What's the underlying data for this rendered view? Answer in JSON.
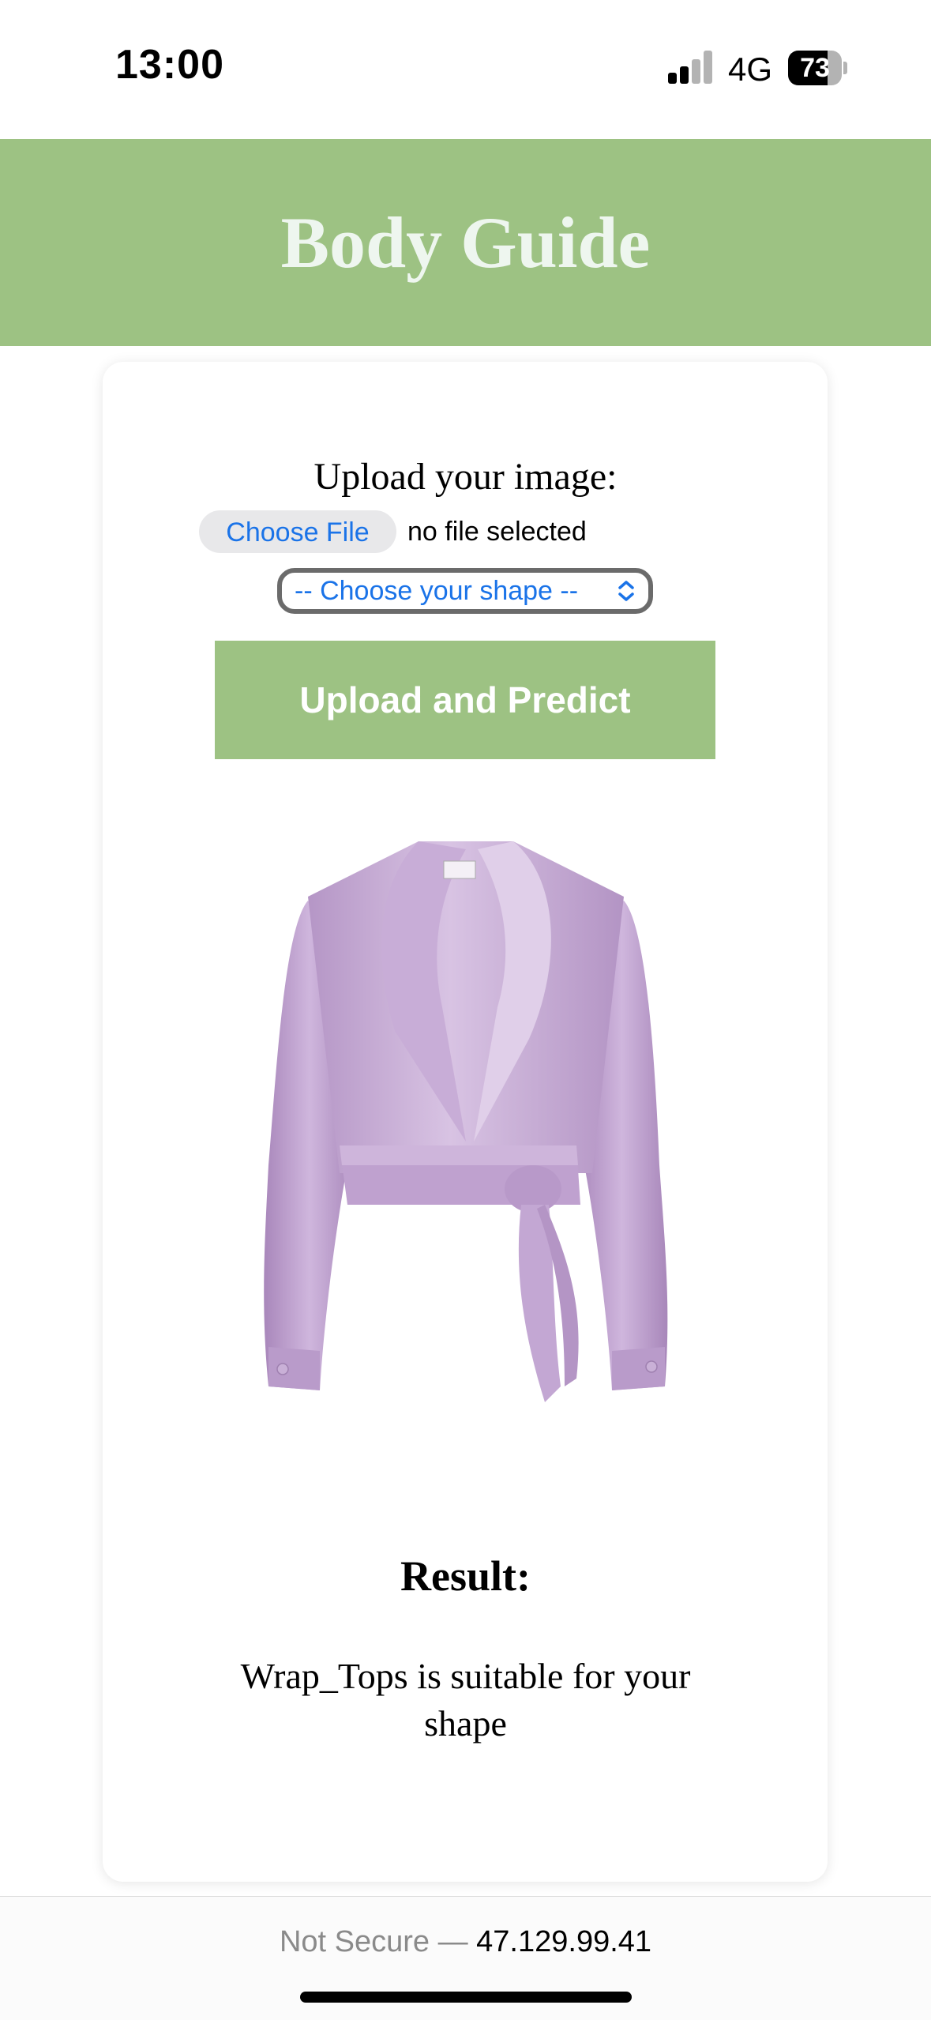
{
  "status_bar": {
    "time": "13:00",
    "network": "4G",
    "battery_percent": "73",
    "battery_level": 0.73,
    "signal_bars_active": 2,
    "signal_bars_total": 4
  },
  "header": {
    "title": "Body Guide",
    "color": "#9dc283"
  },
  "form": {
    "upload_label": "Upload your image:",
    "choose_file_label": "Choose File",
    "file_status": "no file selected",
    "shape_select_value": "-- Choose your shape --",
    "submit_label": "Upload and Predict"
  },
  "product_image": {
    "icon": "wrap-top-blouse-image",
    "color": "#c7a9d6"
  },
  "result": {
    "title": "Result:",
    "text": "Wrap_Tops is suitable for your shape"
  },
  "browser": {
    "security_label": "Not Secure —",
    "address": "47.129.99.41"
  }
}
